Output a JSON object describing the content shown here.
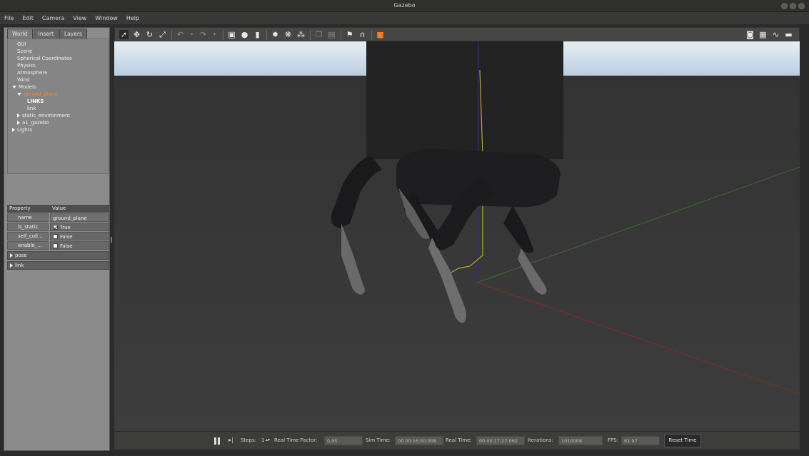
{
  "window": {
    "title": "Gazebo"
  },
  "menu": [
    "File",
    "Edit",
    "Camera",
    "View",
    "Window",
    "Help"
  ],
  "left_panel": {
    "tabs": [
      "World",
      "Insert",
      "Layers"
    ],
    "tree": [
      {
        "label": "GUI",
        "indent": 1,
        "arrow": ""
      },
      {
        "label": "Scene",
        "indent": 1,
        "arrow": ""
      },
      {
        "label": "Spherical Coordinates",
        "indent": 1,
        "arrow": ""
      },
      {
        "label": "Physics",
        "indent": 1,
        "arrow": ""
      },
      {
        "label": "Atmosphere",
        "indent": 1,
        "arrow": ""
      },
      {
        "label": "Wind",
        "indent": 1,
        "arrow": ""
      },
      {
        "label": "Models",
        "indent": 0,
        "arrow": "down"
      },
      {
        "label": "ground_plane",
        "indent": 1,
        "arrow": "down",
        "selected": true
      },
      {
        "label": "LINKS",
        "indent": 3,
        "arrow": "",
        "bold": true
      },
      {
        "label": "link",
        "indent": 3,
        "arrow": ""
      },
      {
        "label": "static_environment",
        "indent": 1,
        "arrow": "right"
      },
      {
        "label": "a1_gazebo",
        "indent": 1,
        "arrow": "right"
      },
      {
        "label": "Lights",
        "indent": 0,
        "arrow": "right"
      }
    ],
    "properties": {
      "header_property": "Property",
      "header_value": "Value",
      "rows": [
        {
          "key": "name",
          "value": "ground_plane",
          "checkbox": null
        },
        {
          "key": "is_static",
          "value": "True",
          "checkbox": true
        },
        {
          "key": "self_coll...",
          "value": "False",
          "checkbox": false
        },
        {
          "key": "enable_...",
          "value": "False",
          "checkbox": false
        }
      ],
      "groups": [
        "pose",
        "link"
      ]
    }
  },
  "toolbar": {
    "icons": [
      "select-mode-icon",
      "translate-mode-icon",
      "rotate-mode-icon",
      "scale-mode-icon",
      "undo-icon",
      "undo-history-icon",
      "redo-icon",
      "redo-history-icon",
      "box-shape-icon",
      "sphere-shape-icon",
      "cylinder-shape-icon",
      "point-light-icon",
      "spot-light-icon",
      "directional-light-icon",
      "copy-icon",
      "paste-icon",
      "align-icon",
      "snap-icon",
      "change-view-icon",
      "screenshot-icon",
      "log-icon",
      "plot-icon",
      "video-record-icon"
    ]
  },
  "bottom_bar": {
    "steps_label": "Steps:",
    "steps_value": "1",
    "rtf_label": "Real Time Factor:",
    "rtf_value": "0.95",
    "sim_time_label": "Sim Time:",
    "sim_time_value": "00 00:16:50.008",
    "real_time_label": "Real Time:",
    "real_time_value": "00 00:17:27.062",
    "iterations_label": "Iterations:",
    "iterations_value": "1010008",
    "fps_label": "FPS:",
    "fps_value": "61.97",
    "reset_label": "Reset Time"
  },
  "colors": {
    "selected_item": "#ff8a1e",
    "sky": "#c8d9e6",
    "ground": "#3a3a3a",
    "axis_x": "#8a2a20",
    "axis_y": "#3f6a32",
    "axis_z": "#2c2f80"
  }
}
